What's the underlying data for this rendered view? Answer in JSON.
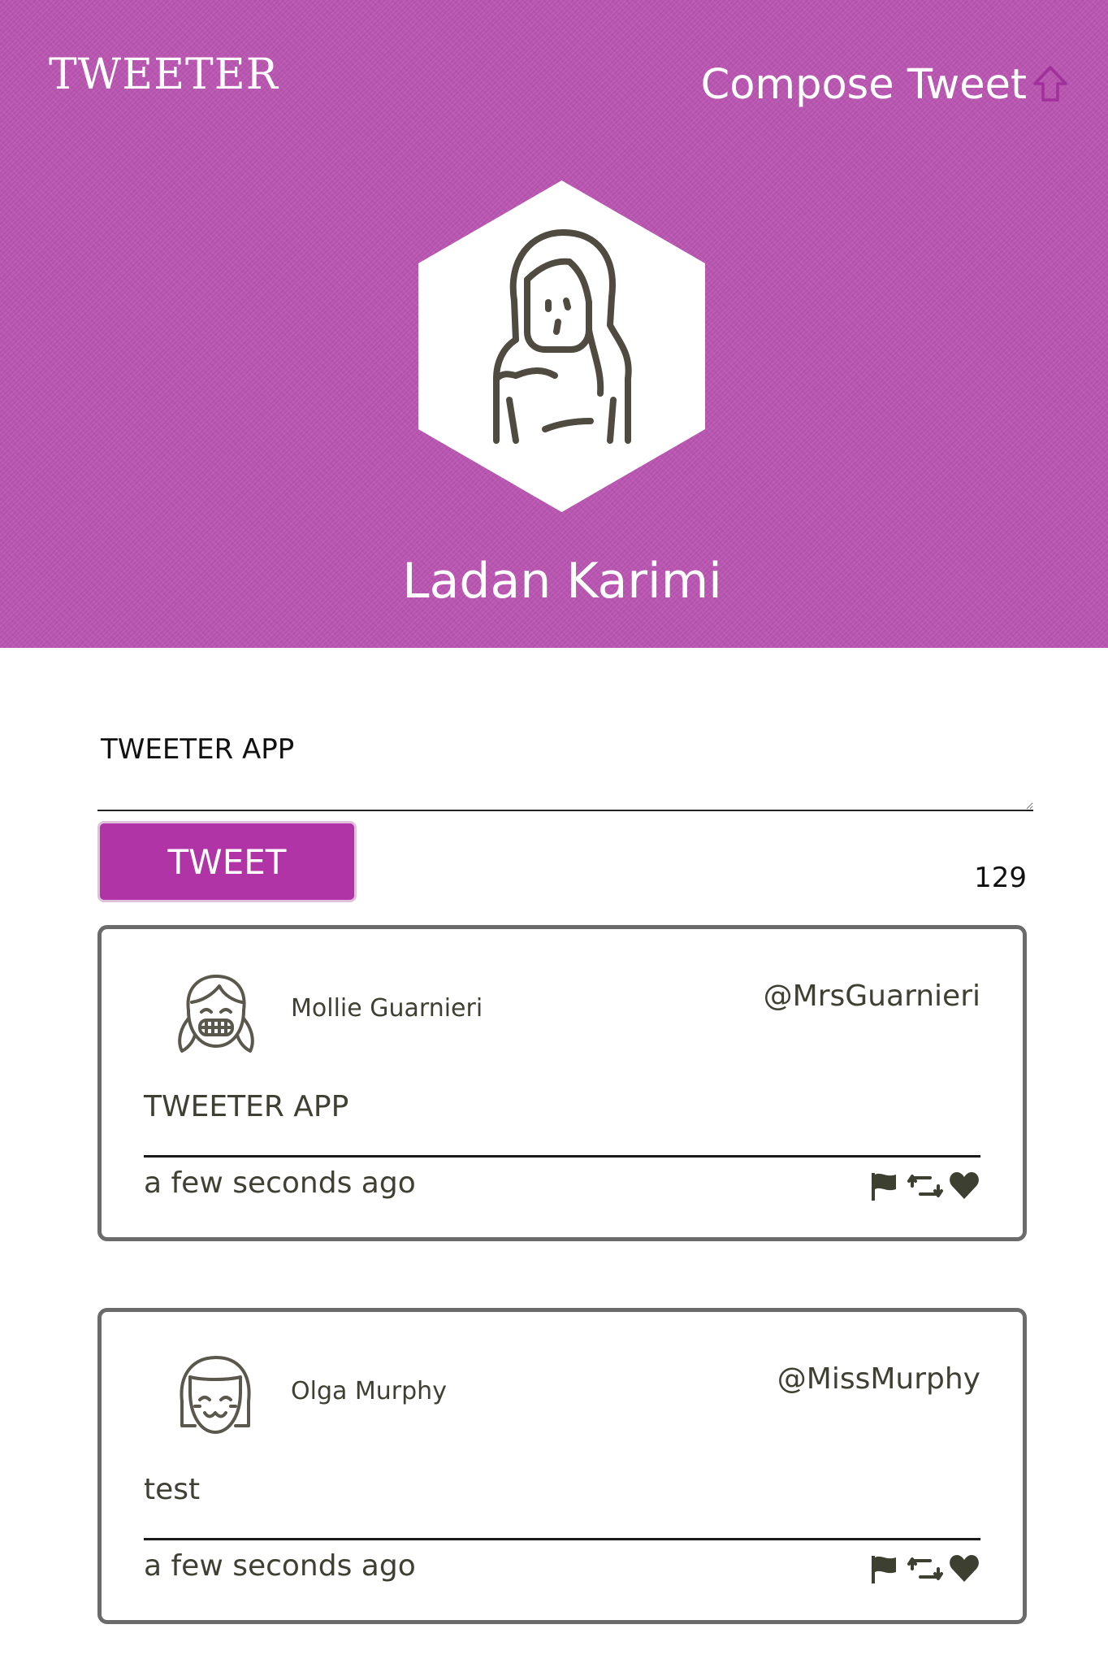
{
  "app": {
    "brand": "TWEETER"
  },
  "nav": {
    "compose_label": "Compose Tweet",
    "compose_icon": "arrow-up-icon"
  },
  "profile": {
    "name": "Ladan Karimi",
    "avatar_icon": "woman-avatar-icon"
  },
  "composer": {
    "value": "TWEETER APP",
    "button_label": "TWEET",
    "counter": "129"
  },
  "tweets": [
    {
      "name": "Mollie Guarnieri",
      "handle": "@MrsGuarnieri",
      "text": "TWEETER APP",
      "time": "a few seconds ago",
      "avatar_icon": "girl-pigtails-avatar-icon"
    },
    {
      "name": "Olga Murphy",
      "handle": "@MissMurphy",
      "text": "test",
      "time": "a few seconds ago",
      "avatar_icon": "girl-bangs-avatar-icon"
    }
  ],
  "colors": {
    "header_bg": "#bb55b2",
    "button_bg": "#b134a7",
    "text_dark": "#3f3f33"
  }
}
